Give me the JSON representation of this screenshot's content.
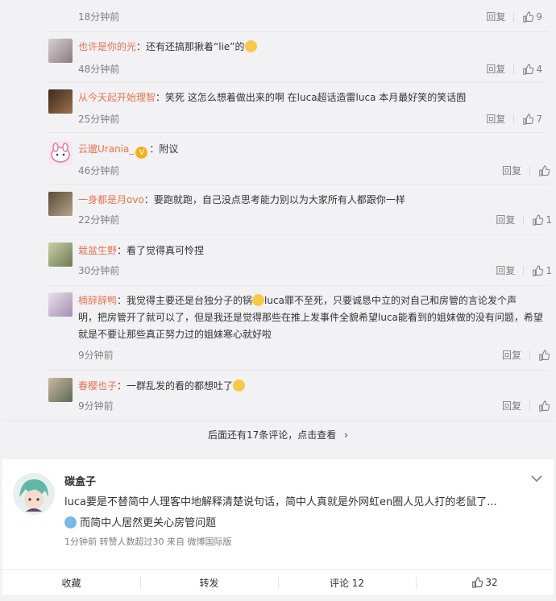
{
  "comments": [
    {
      "name": "",
      "sep": "",
      "text": "",
      "time": "18分钟前",
      "reply": "回复",
      "likes": "9"
    },
    {
      "name": "也许是你的光",
      "sep": "：",
      "text": "还有还搞那揪着“lie”的",
      "time": "48分钟前",
      "reply": "回复",
      "likes": "4"
    },
    {
      "name": "从今天起开始理智",
      "sep": "：",
      "text": "笑死 这怎么想着做出来的啊 在luca超话造雷luca 本月最好笑的笑话囿",
      "time": "25分钟前",
      "reply": "回复",
      "likes": "7"
    },
    {
      "name": "云邈Urania_",
      "sep": "：",
      "text": "附议",
      "time": "46分钟前",
      "reply": "回复",
      "likes": ""
    },
    {
      "name": "一身都是月ovo",
      "sep": "：",
      "text": "要跑就跑，自己没点思考能力别以为大家所有人都跟你一样",
      "time": "22分钟前",
      "reply": "回复",
      "likes": "1"
    },
    {
      "name": "栽盆生野",
      "sep": "：",
      "text": "看了觉得真可怜捏",
      "time": "30分钟前",
      "reply": "回复",
      "likes": "1"
    },
    {
      "name": "楠辞辞鸭",
      "sep": "：",
      "text_a": "我觉得主要还是台独分子的锅",
      "text_b": "luca罪不至死，只要诚恳中立的对自己和房管的言论发个声",
      "text_c": "明，把房管开了就可以了，但是我还是觉得那些在推上发事件全貌希望luca能看到的姐妹做的没有问题，希望",
      "text_d": "就是不要让那些真正努力过的姐妹寒心就好啦",
      "time": "9分钟前",
      "reply": "回复",
      "likes": ""
    },
    {
      "name": "春樱也子",
      "sep": "：",
      "text": "一群乱发的看的都想吐了",
      "time": "9分钟前",
      "reply": "回复",
      "likes": ""
    }
  ],
  "more": {
    "label": "后面还有17条评论，点击查看",
    "chevron": "›"
  },
  "post": {
    "author": "碳盒子",
    "text": "luca要是不替简中人理客中地解释清楚说句话，简中人真就是外网虹en圈人见人打的老鼠了...",
    "text2": "而简中人居然更关心房管问题",
    "meta": "1分钟前 转赞人数超过30  来自 微博国际版",
    "actions": {
      "collect": "收藏",
      "repost": "转发",
      "comment": "评论 12",
      "like": "32"
    }
  },
  "colors": {
    "name": "#eb7350",
    "muted": "#808080",
    "bg": "#f2f2f5",
    "vbadge": "#f5b018"
  },
  "icons": [
    "thumb-up-icon",
    "chevron-down-icon",
    "chevron-right-icon",
    "verified-badge-icon",
    "emoji-icon"
  ]
}
